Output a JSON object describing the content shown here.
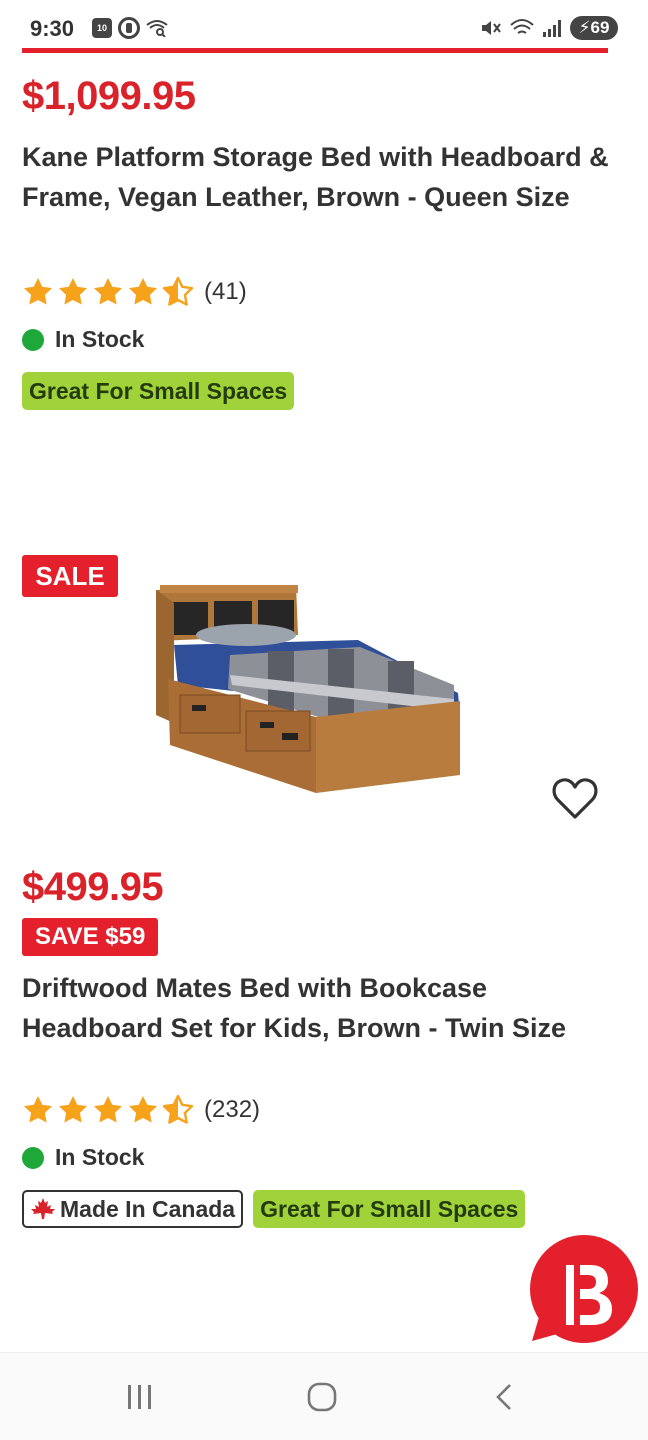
{
  "status_bar": {
    "time": "9:30",
    "calendar_day": "10",
    "battery": "69"
  },
  "product1": {
    "price": "$1,099.95",
    "title": "Kane Platform Storage Bed with Headboard & Frame, Vegan Leather, Brown - Queen Size",
    "rating": 4.5,
    "review_count": "(41)",
    "stock": "In Stock",
    "badges": [
      "Great For Small Spaces"
    ]
  },
  "product2": {
    "sale_tag": "SALE",
    "image": "wooden-bookcase-bed-image",
    "price": "$499.95",
    "save_tag": "SAVE $59",
    "title": "Driftwood Mates Bed with Bookcase Headboard Set for Kids, Brown - Twin Size",
    "rating": 4.5,
    "review_count": "(232)",
    "stock": "In Stock",
    "badge_canada": "Made In Canada",
    "badge_small_spaces": "Great For Small Spaces"
  },
  "colors": {
    "brand_red": "#e3202b",
    "price_red": "#d9222a",
    "star": "#f7a21b",
    "in_stock_green": "#1fa83a",
    "badge_green": "#9fd339"
  },
  "icons": {
    "wishlist": "heart-outline-icon",
    "chat": "brand-chat-icon",
    "nav_recent": "recent-apps-icon",
    "nav_home": "home-icon",
    "nav_back": "back-icon"
  }
}
